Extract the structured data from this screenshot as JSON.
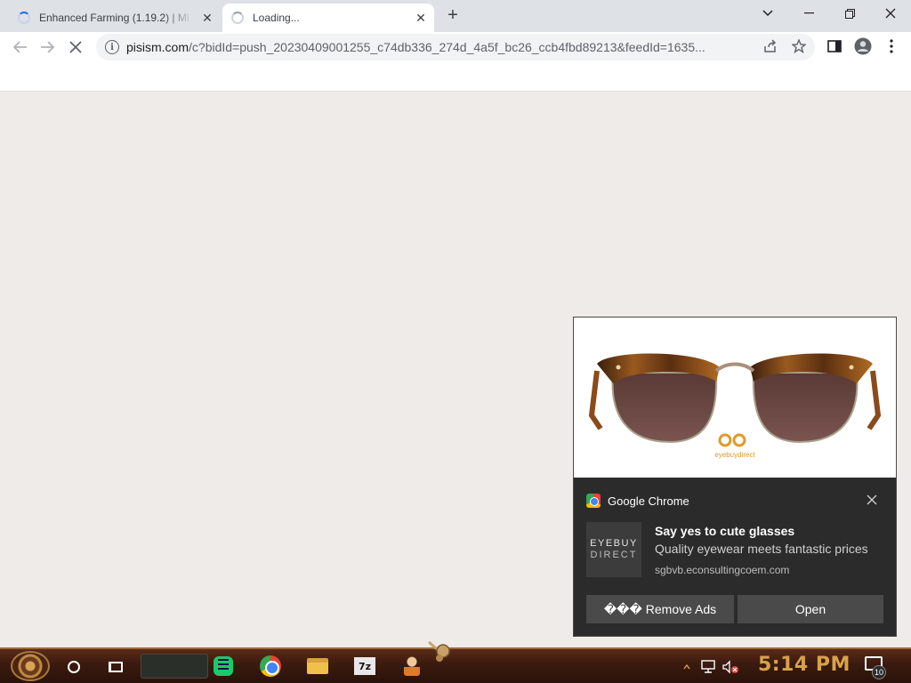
{
  "tabs": [
    {
      "title": "Enhanced Farming (1.19.2) | Mi",
      "state": "loading"
    },
    {
      "title": "Loading...",
      "state": "loading-active"
    }
  ],
  "toolbar": {
    "url_host": "pisism.com",
    "url_path": "/c?bidId=push_20230409001255_c74db336_274d_4a5f_bc26_ccb4fbd89213&feedId=1635..."
  },
  "notification": {
    "source": "Google Chrome",
    "logo_line1": "EYEBUY",
    "logo_line2": "DIRECT",
    "title": "Say yes to cute glasses",
    "body": "Quality eyewear meets fantastic prices",
    "site": "sgbvb.econsultingcoem.com",
    "remove_ads_label": "��� Remove Ads",
    "open_label": "Open",
    "hero_brand": "eyebuydirect"
  },
  "taskbar": {
    "clock": "5:14 PM",
    "notification_count": "10",
    "apps": [
      "green-notes-app",
      "chrome",
      "file-explorer",
      "7-zip",
      "user-app"
    ]
  },
  "colors": {
    "page_bg": "#efebe9",
    "tabstrip_bg": "#dee1e6",
    "notification_bg": "#2b2b2b",
    "clock_color": "#d8a24a",
    "loading_blue": "#1a73e8"
  }
}
